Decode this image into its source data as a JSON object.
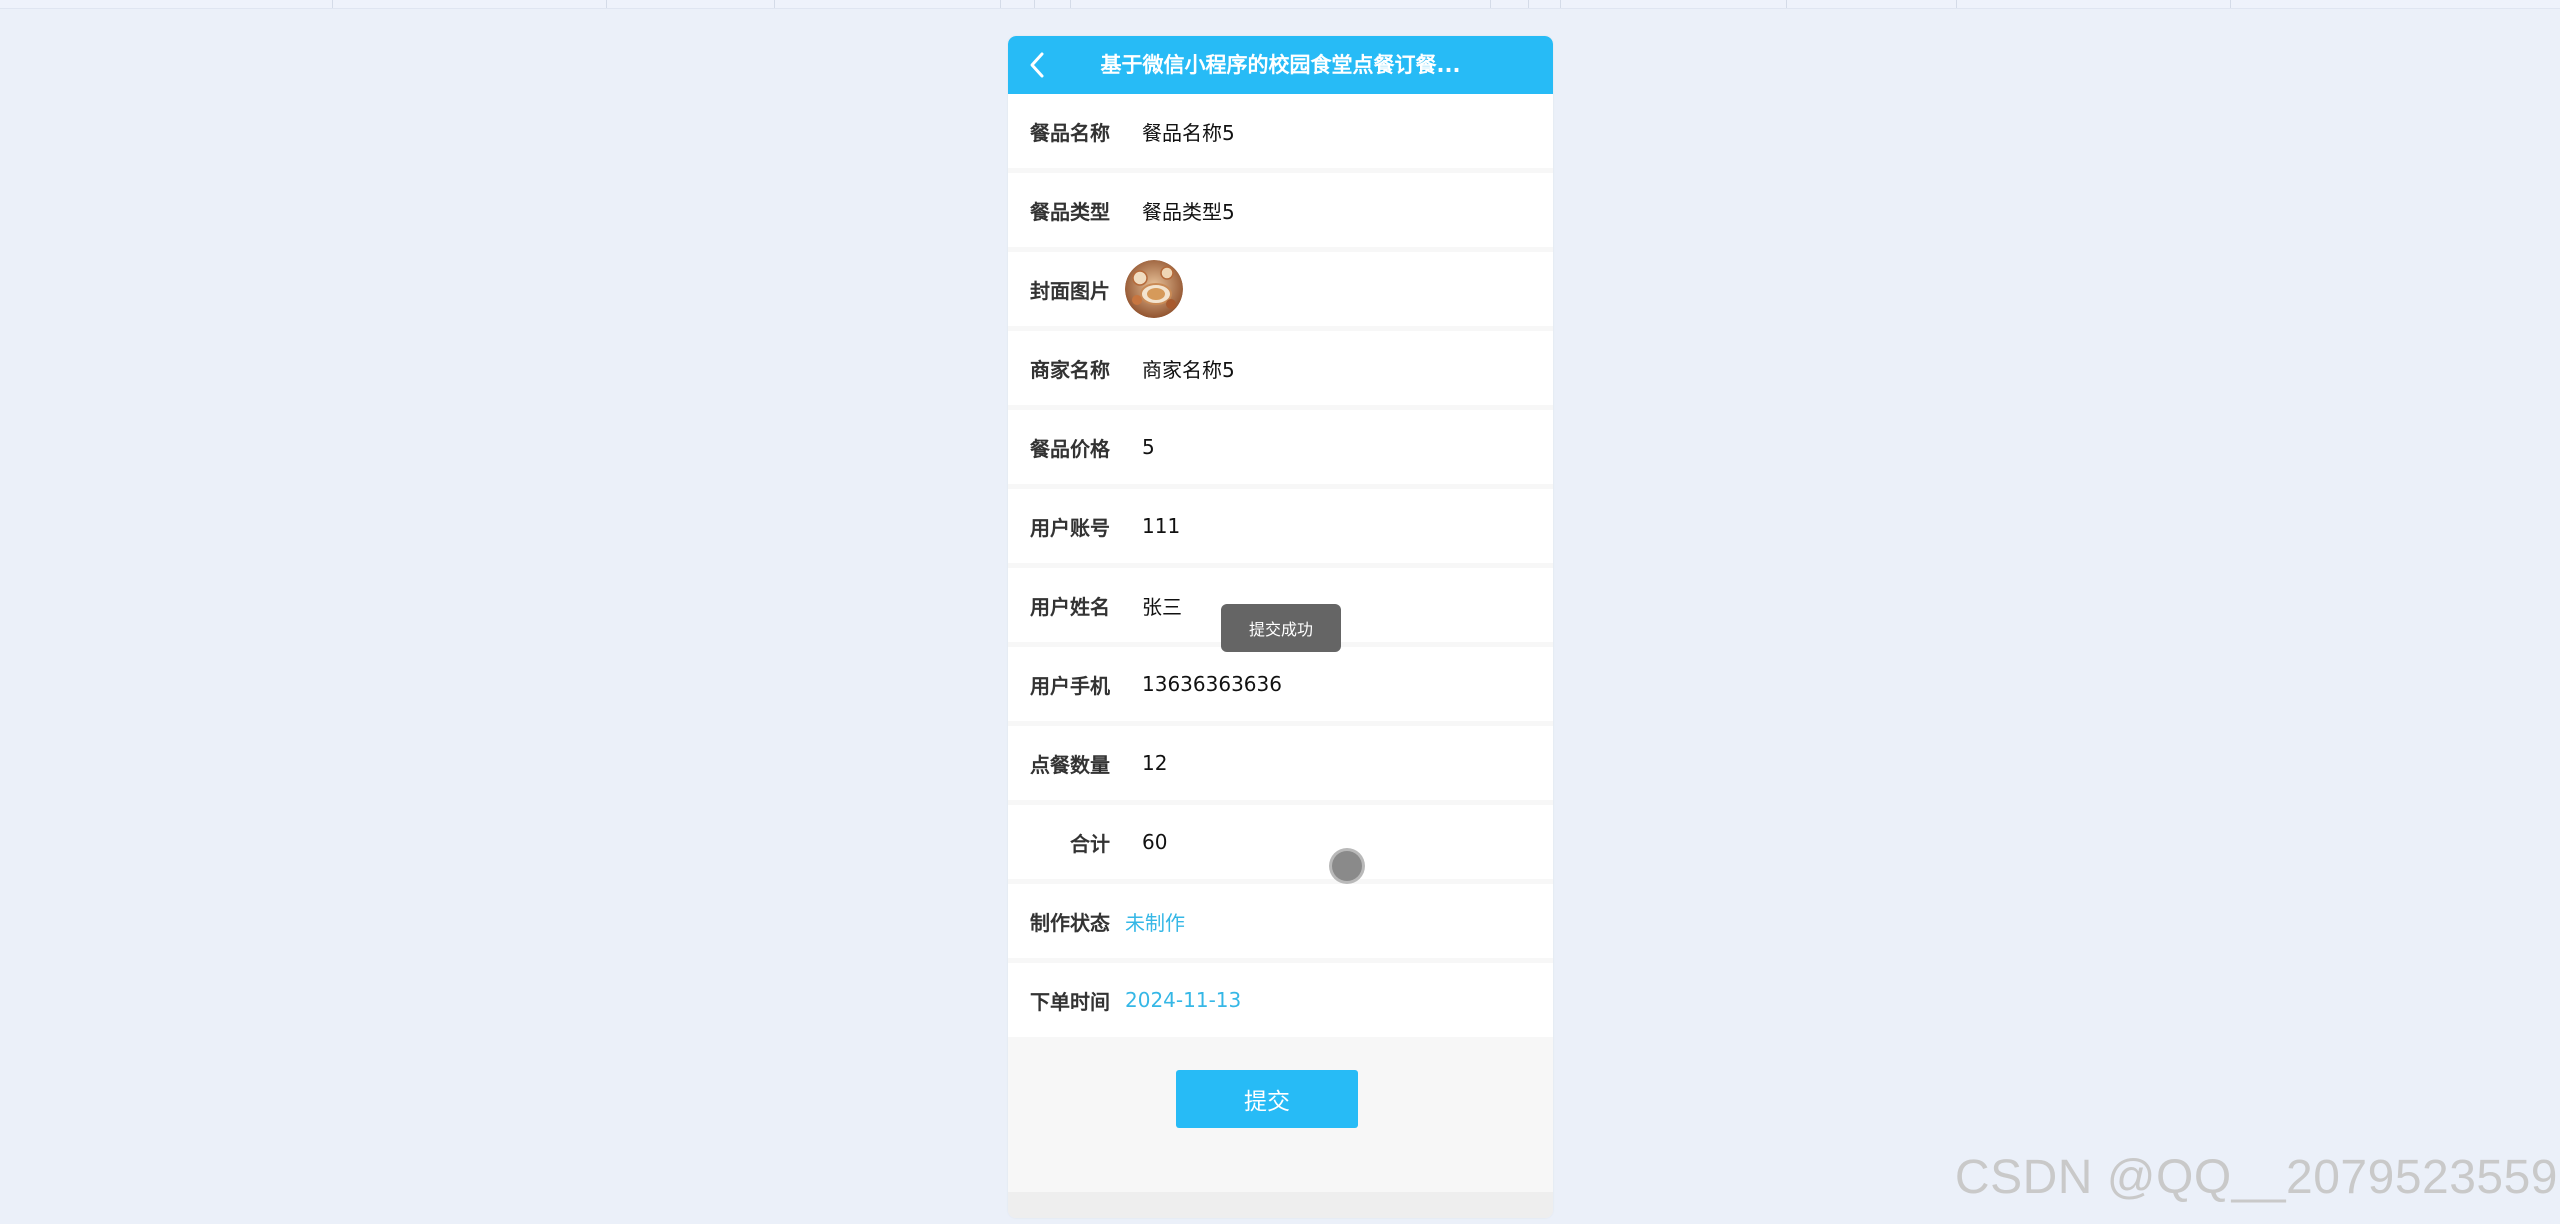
{
  "nav": {
    "title": "基于微信小程序的校园食堂点餐订餐...",
    "back_icon": "chevron-left-icon"
  },
  "fields": [
    {
      "label": "餐品名称",
      "value": "餐品名称5",
      "kind": "text"
    },
    {
      "label": "餐品类型",
      "value": "餐品类型5",
      "kind": "text"
    },
    {
      "label": "封面图片",
      "value": "",
      "kind": "image"
    },
    {
      "label": "商家名称",
      "value": "商家名称5",
      "kind": "text"
    },
    {
      "label": "餐品价格",
      "value": "5",
      "kind": "text"
    },
    {
      "label": "用户账号",
      "value": "111",
      "kind": "text"
    },
    {
      "label": "用户姓名",
      "value": "张三",
      "kind": "text"
    },
    {
      "label": "用户手机",
      "value": "13636363636",
      "kind": "text"
    },
    {
      "label": "点餐数量",
      "value": "12",
      "kind": "text"
    },
    {
      "label": "合计",
      "value": "60",
      "kind": "text"
    },
    {
      "label": "制作状态",
      "value": "未制作",
      "kind": "link"
    },
    {
      "label": "下单时间",
      "value": "2024-11-13",
      "kind": "link"
    }
  ],
  "submit": {
    "label": "提交"
  },
  "toast": {
    "text": "提交成功"
  },
  "watermark": {
    "text": "CSDN @QQ__2079523559"
  },
  "colors": {
    "accent": "#27bbf6",
    "link": "#35b7e6",
    "background": "#ebf0f9"
  }
}
